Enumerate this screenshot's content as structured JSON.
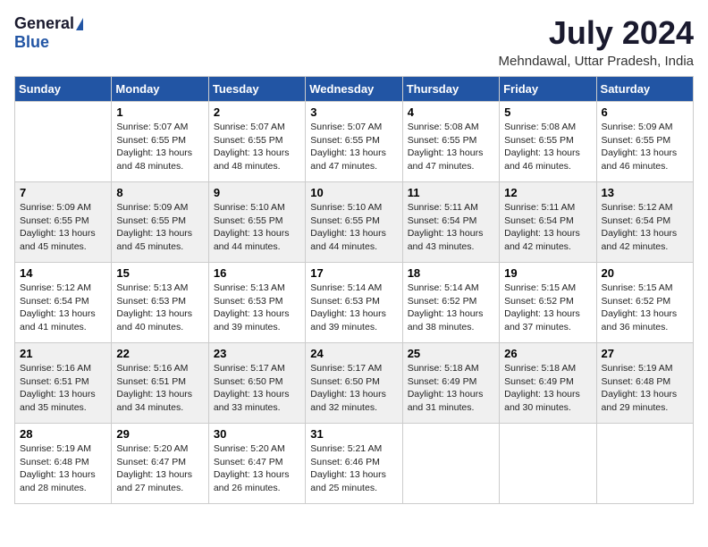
{
  "logo": {
    "general": "General",
    "blue": "Blue"
  },
  "title": "July 2024",
  "location": "Mehndawal, Uttar Pradesh, India",
  "days": [
    "Sunday",
    "Monday",
    "Tuesday",
    "Wednesday",
    "Thursday",
    "Friday",
    "Saturday"
  ],
  "weeks": [
    [
      {
        "date": "",
        "info": ""
      },
      {
        "date": "1",
        "info": "Sunrise: 5:07 AM\nSunset: 6:55 PM\nDaylight: 13 hours\nand 48 minutes."
      },
      {
        "date": "2",
        "info": "Sunrise: 5:07 AM\nSunset: 6:55 PM\nDaylight: 13 hours\nand 48 minutes."
      },
      {
        "date": "3",
        "info": "Sunrise: 5:07 AM\nSunset: 6:55 PM\nDaylight: 13 hours\nand 47 minutes."
      },
      {
        "date": "4",
        "info": "Sunrise: 5:08 AM\nSunset: 6:55 PM\nDaylight: 13 hours\nand 47 minutes."
      },
      {
        "date": "5",
        "info": "Sunrise: 5:08 AM\nSunset: 6:55 PM\nDaylight: 13 hours\nand 46 minutes."
      },
      {
        "date": "6",
        "info": "Sunrise: 5:09 AM\nSunset: 6:55 PM\nDaylight: 13 hours\nand 46 minutes."
      }
    ],
    [
      {
        "date": "7",
        "info": "Sunrise: 5:09 AM\nSunset: 6:55 PM\nDaylight: 13 hours\nand 45 minutes."
      },
      {
        "date": "8",
        "info": "Sunrise: 5:09 AM\nSunset: 6:55 PM\nDaylight: 13 hours\nand 45 minutes."
      },
      {
        "date": "9",
        "info": "Sunrise: 5:10 AM\nSunset: 6:55 PM\nDaylight: 13 hours\nand 44 minutes."
      },
      {
        "date": "10",
        "info": "Sunrise: 5:10 AM\nSunset: 6:55 PM\nDaylight: 13 hours\nand 44 minutes."
      },
      {
        "date": "11",
        "info": "Sunrise: 5:11 AM\nSunset: 6:54 PM\nDaylight: 13 hours\nand 43 minutes."
      },
      {
        "date": "12",
        "info": "Sunrise: 5:11 AM\nSunset: 6:54 PM\nDaylight: 13 hours\nand 42 minutes."
      },
      {
        "date": "13",
        "info": "Sunrise: 5:12 AM\nSunset: 6:54 PM\nDaylight: 13 hours\nand 42 minutes."
      }
    ],
    [
      {
        "date": "14",
        "info": "Sunrise: 5:12 AM\nSunset: 6:54 PM\nDaylight: 13 hours\nand 41 minutes."
      },
      {
        "date": "15",
        "info": "Sunrise: 5:13 AM\nSunset: 6:53 PM\nDaylight: 13 hours\nand 40 minutes."
      },
      {
        "date": "16",
        "info": "Sunrise: 5:13 AM\nSunset: 6:53 PM\nDaylight: 13 hours\nand 39 minutes."
      },
      {
        "date": "17",
        "info": "Sunrise: 5:14 AM\nSunset: 6:53 PM\nDaylight: 13 hours\nand 39 minutes."
      },
      {
        "date": "18",
        "info": "Sunrise: 5:14 AM\nSunset: 6:52 PM\nDaylight: 13 hours\nand 38 minutes."
      },
      {
        "date": "19",
        "info": "Sunrise: 5:15 AM\nSunset: 6:52 PM\nDaylight: 13 hours\nand 37 minutes."
      },
      {
        "date": "20",
        "info": "Sunrise: 5:15 AM\nSunset: 6:52 PM\nDaylight: 13 hours\nand 36 minutes."
      }
    ],
    [
      {
        "date": "21",
        "info": "Sunrise: 5:16 AM\nSunset: 6:51 PM\nDaylight: 13 hours\nand 35 minutes."
      },
      {
        "date": "22",
        "info": "Sunrise: 5:16 AM\nSunset: 6:51 PM\nDaylight: 13 hours\nand 34 minutes."
      },
      {
        "date": "23",
        "info": "Sunrise: 5:17 AM\nSunset: 6:50 PM\nDaylight: 13 hours\nand 33 minutes."
      },
      {
        "date": "24",
        "info": "Sunrise: 5:17 AM\nSunset: 6:50 PM\nDaylight: 13 hours\nand 32 minutes."
      },
      {
        "date": "25",
        "info": "Sunrise: 5:18 AM\nSunset: 6:49 PM\nDaylight: 13 hours\nand 31 minutes."
      },
      {
        "date": "26",
        "info": "Sunrise: 5:18 AM\nSunset: 6:49 PM\nDaylight: 13 hours\nand 30 minutes."
      },
      {
        "date": "27",
        "info": "Sunrise: 5:19 AM\nSunset: 6:48 PM\nDaylight: 13 hours\nand 29 minutes."
      }
    ],
    [
      {
        "date": "28",
        "info": "Sunrise: 5:19 AM\nSunset: 6:48 PM\nDaylight: 13 hours\nand 28 minutes."
      },
      {
        "date": "29",
        "info": "Sunrise: 5:20 AM\nSunset: 6:47 PM\nDaylight: 13 hours\nand 27 minutes."
      },
      {
        "date": "30",
        "info": "Sunrise: 5:20 AM\nSunset: 6:47 PM\nDaylight: 13 hours\nand 26 minutes."
      },
      {
        "date": "31",
        "info": "Sunrise: 5:21 AM\nSunset: 6:46 PM\nDaylight: 13 hours\nand 25 minutes."
      },
      {
        "date": "",
        "info": ""
      },
      {
        "date": "",
        "info": ""
      },
      {
        "date": "",
        "info": ""
      }
    ]
  ]
}
